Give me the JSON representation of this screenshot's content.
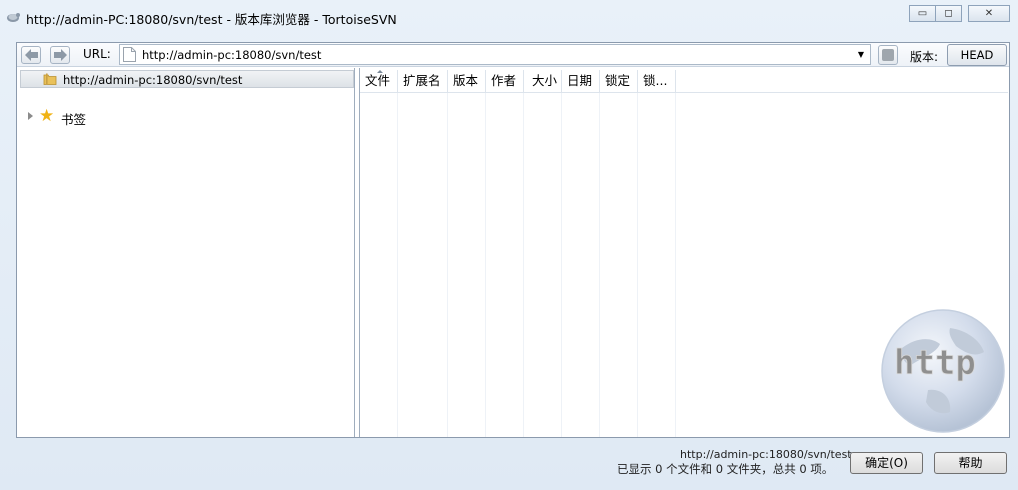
{
  "window": {
    "title": "http://admin-PC:18080/svn/test - 版本库浏览器 - TortoiseSVN",
    "min_label": "▭",
    "max_label": "◻",
    "close_label": "✕"
  },
  "toolbar": {
    "url_label": "URL:",
    "url_value": "http://admin-pc:18080/svn/test",
    "revision_label": "版本:",
    "revision_value": "HEAD"
  },
  "tree": {
    "root_label": "http://admin-pc:18080/svn/test",
    "bookmarks_label": "书签"
  },
  "file_list": {
    "columns": [
      "文件",
      "扩展名",
      "版本",
      "作者",
      "大小",
      "日期",
      "锁定",
      "锁..."
    ]
  },
  "watermark_text": "http",
  "status": {
    "url": "http://admin-pc:18080/svn/test",
    "summary": "已显示 0 个文件和 0 文件夹，总共 0 项。"
  },
  "buttons": {
    "ok_label": "确定(O)",
    "help_label": "帮助"
  }
}
